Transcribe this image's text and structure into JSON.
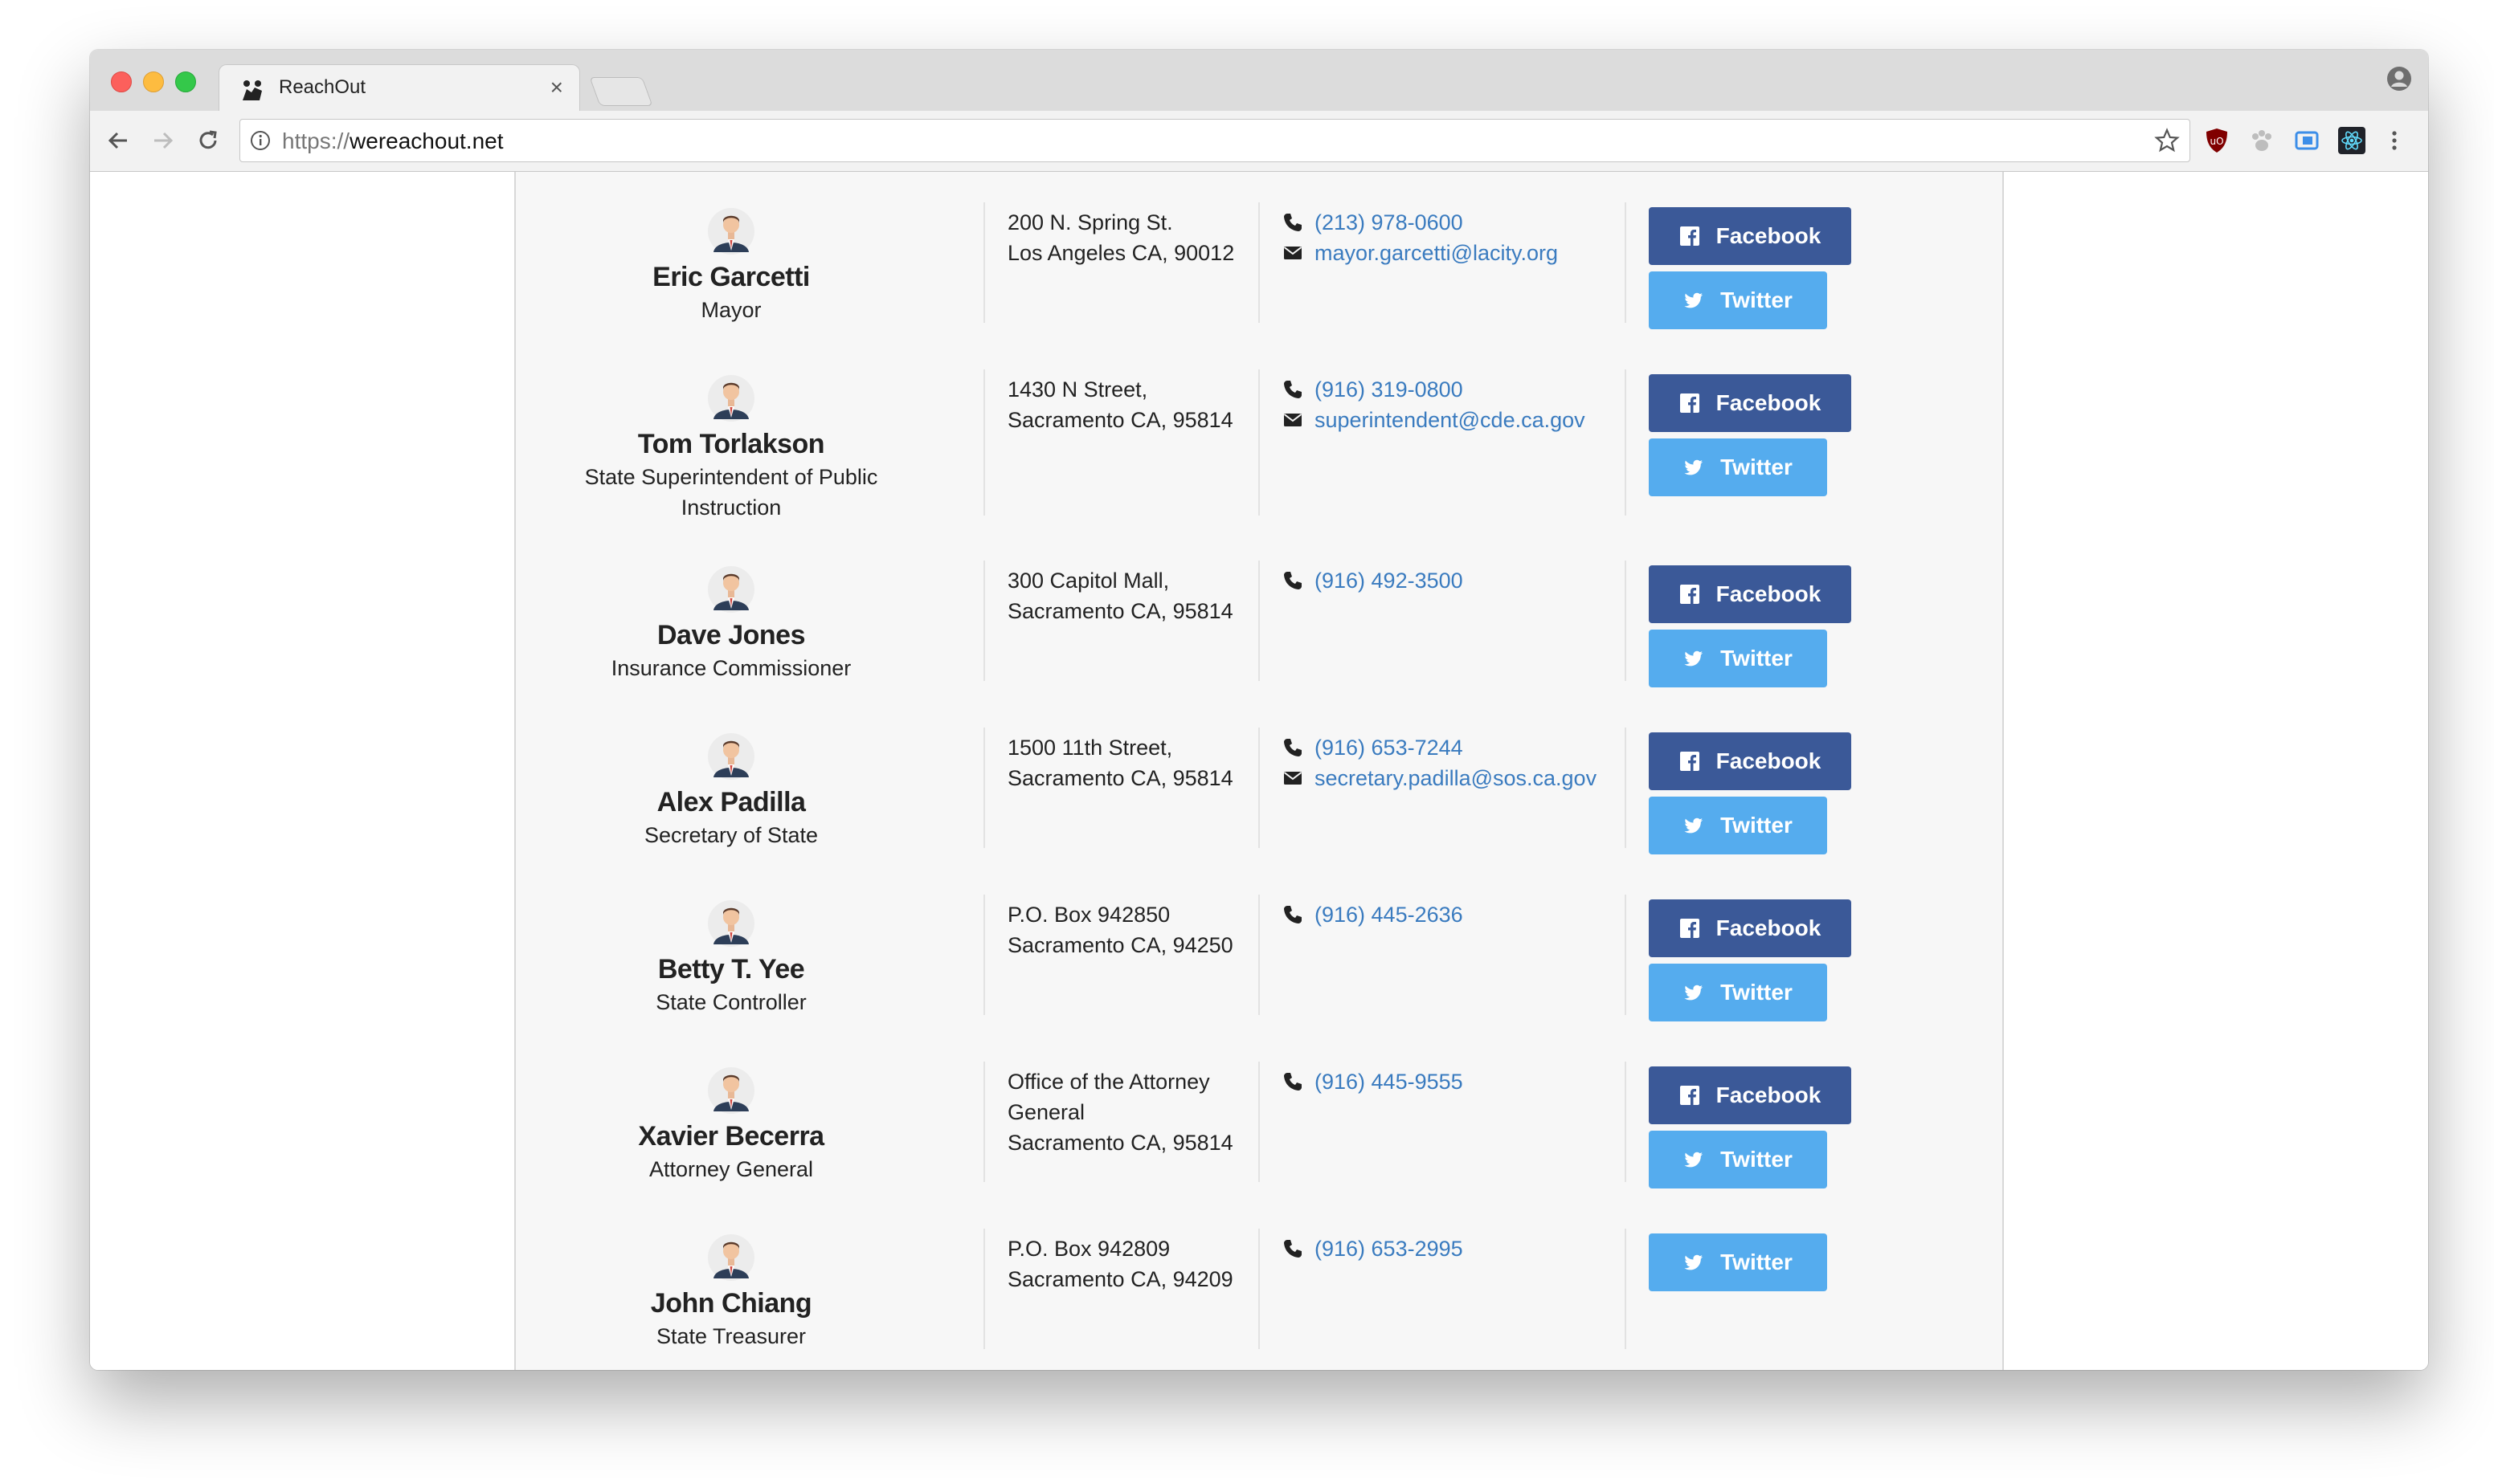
{
  "browser": {
    "tab_title": "ReachOut",
    "tab_close": "×",
    "url_scheme": "https://",
    "url_host": "wereachout.net"
  },
  "colors": {
    "facebook": "#3b5998",
    "twitter": "#55acee",
    "link": "#3a7bbf"
  },
  "officials": [
    {
      "name": "Eric Garcetti",
      "title": "Mayor",
      "address": [
        "200 N. Spring St.",
        "Los Angeles CA, 90012"
      ],
      "phone": "(213) 978-0600",
      "email": "mayor.garcetti@lacity.org",
      "facebook": "Facebook",
      "twitter": "Twitter"
    },
    {
      "name": "Tom Torlakson",
      "title": "State Superintendent of Public Instruction",
      "address": [
        "1430 N Street,",
        "Sacramento CA, 95814"
      ],
      "phone": "(916) 319-0800",
      "email": "superintendent@cde.ca.gov",
      "facebook": "Facebook",
      "twitter": "Twitter"
    },
    {
      "name": "Dave Jones",
      "title": "Insurance Commissioner",
      "address": [
        "300 Capitol Mall,",
        "Sacramento CA, 95814"
      ],
      "phone": "(916) 492-3500",
      "facebook": "Facebook",
      "twitter": "Twitter"
    },
    {
      "name": "Alex Padilla",
      "title": "Secretary of State",
      "address": [
        "1500 11th Street,",
        "Sacramento CA, 95814"
      ],
      "phone": "(916) 653-7244",
      "email": "secretary.padilla@sos.ca.gov",
      "facebook": "Facebook",
      "twitter": "Twitter"
    },
    {
      "name": "Betty T. Yee",
      "title": "State Controller",
      "address": [
        "P.O. Box 942850",
        "Sacramento CA, 94250"
      ],
      "phone": "(916) 445-2636",
      "facebook": "Facebook",
      "twitter": "Twitter"
    },
    {
      "name": "Xavier Becerra",
      "title": "Attorney General",
      "address": [
        "Office of the Attorney General",
        "Sacramento CA, 95814"
      ],
      "phone": "(916) 445-9555",
      "facebook": "Facebook",
      "twitter": "Twitter"
    },
    {
      "name": "John Chiang",
      "title": "State Treasurer",
      "address": [
        "P.O. Box 942809",
        "Sacramento CA, 94209"
      ],
      "phone": "(916) 653-2995",
      "twitter": "Twitter"
    }
  ]
}
